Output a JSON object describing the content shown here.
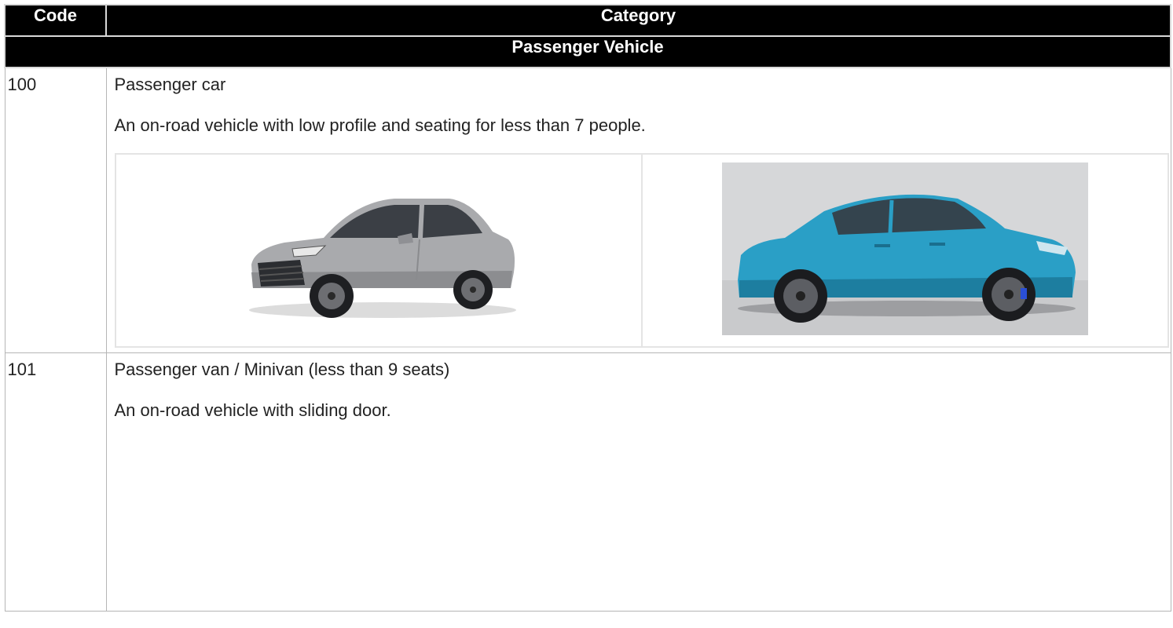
{
  "header": {
    "code_label": "Code",
    "category_label": "Category"
  },
  "group": {
    "title": "Passenger Vehicle"
  },
  "rows": [
    {
      "code": "100",
      "name": "Passenger car",
      "description": "An on-road vehicle with low profile and seating for less than 7 people.",
      "images": [
        {
          "subject": "silver sedan photo"
        },
        {
          "subject": "blue sedan photo"
        }
      ]
    },
    {
      "code": "101",
      "name": "Passenger van / Minivan (less than 9 seats)",
      "description": "An on-road vehicle with sliding door."
    }
  ],
  "colors": {
    "header_bg": "#000000",
    "header_text": "#ffffff",
    "grid": "#b5b5b5",
    "silver_car": "#a9aaad",
    "blue_car": "#2a9fc6",
    "studio_bg": "#d6d7d9"
  }
}
